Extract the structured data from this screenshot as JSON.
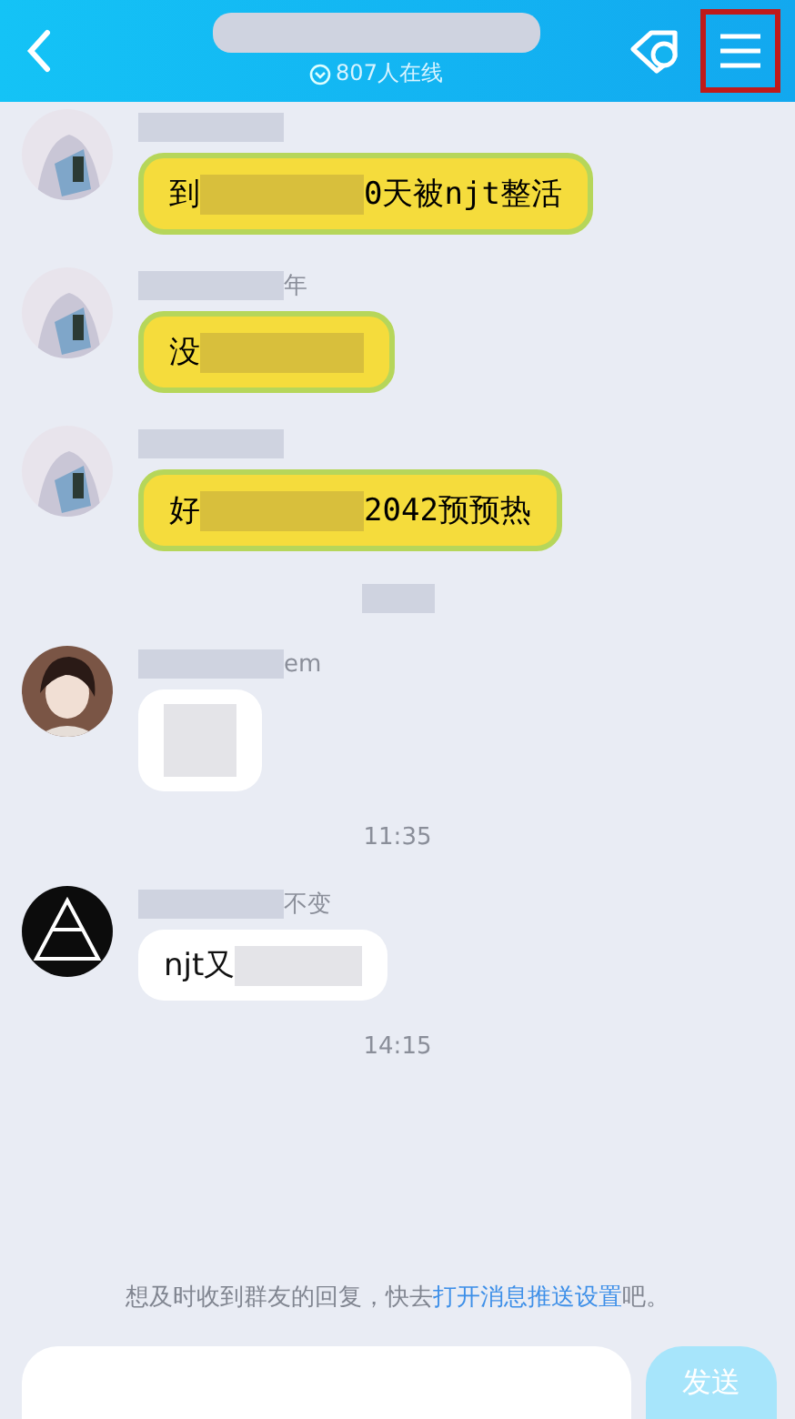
{
  "header": {
    "online": "807人在线"
  },
  "feed": [
    {
      "kind": "message",
      "themed": true,
      "parts": [
        "到",
        "0天被njt整活"
      ]
    },
    {
      "kind": "message",
      "name": "年",
      "themed": true,
      "parts": [
        "没"
      ]
    },
    {
      "kind": "message",
      "themed": true,
      "parts": [
        "好",
        "2042预预热"
      ]
    },
    {
      "kind": "time"
    },
    {
      "kind": "message",
      "name": "em",
      "themed": false
    },
    {
      "kind": "time",
      "text": "11:35"
    },
    {
      "kind": "message",
      "name": "不变",
      "themed": false,
      "parts": [
        "njt又"
      ]
    },
    {
      "kind": "time",
      "text": "14:15"
    }
  ],
  "notice": {
    "text": "想及时收到群友的回复，快去",
    "link": "打开消息推送设置",
    "tail": "吧。"
  },
  "composer": {
    "send": "发送"
  }
}
